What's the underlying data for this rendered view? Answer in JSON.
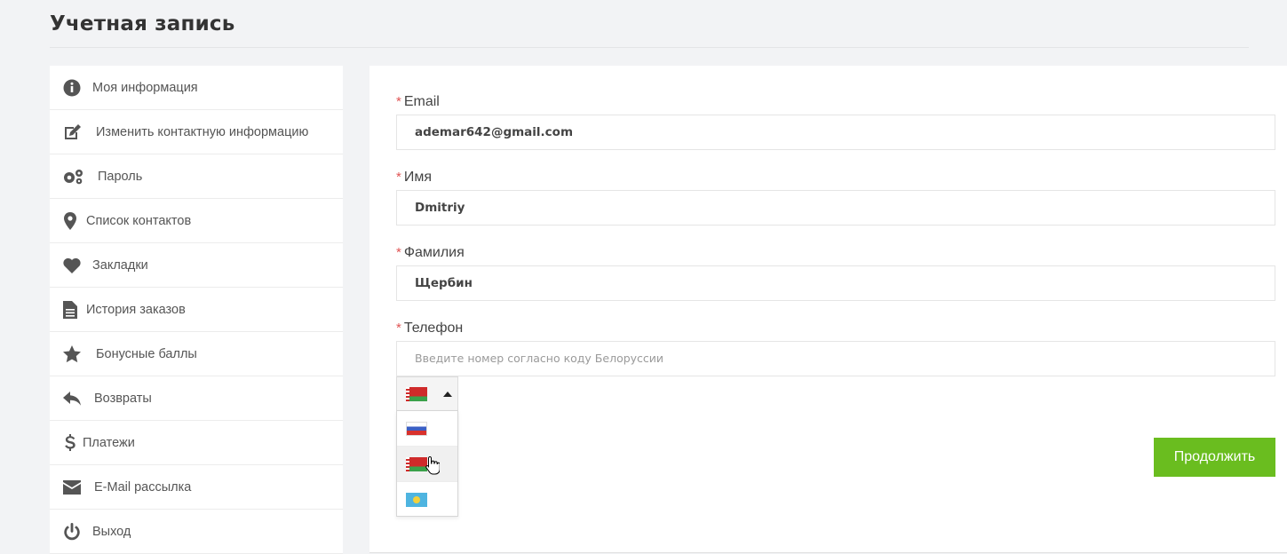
{
  "page": {
    "title": "Учетная запись"
  },
  "sidebar": {
    "items": [
      {
        "label": "Моя информация",
        "icon": "info-icon"
      },
      {
        "label": "Изменить контактную информацию",
        "icon": "edit-icon"
      },
      {
        "label": "Пароль",
        "icon": "gears-icon"
      },
      {
        "label": "Список контактов",
        "icon": "map-marker-icon"
      },
      {
        "label": "Закладки",
        "icon": "heart-icon"
      },
      {
        "label": "История заказов",
        "icon": "document-icon"
      },
      {
        "label": "Бонусные баллы",
        "icon": "star-icon"
      },
      {
        "label": "Возвраты",
        "icon": "reply-icon"
      },
      {
        "label": "Платежи",
        "icon": "dollar-icon"
      },
      {
        "label": "E-Mail рассылка",
        "icon": "envelope-icon"
      },
      {
        "label": "Выход",
        "icon": "power-icon"
      }
    ]
  },
  "form": {
    "required_mark": "*",
    "email": {
      "label": "Email",
      "value": "ademar642@gmail.com"
    },
    "first_name": {
      "label": "Имя",
      "value": "Dmitriy"
    },
    "last_name": {
      "label": "Фамилия",
      "value": "Щербин"
    },
    "phone": {
      "label": "Телефон",
      "value": "",
      "placeholder": "Введите номер согласно коду Белоруссии"
    },
    "country": {
      "selected_flag": "belarus-flag-icon",
      "options": [
        "russia-flag-icon",
        "belarus-flag-icon",
        "kazakhstan-flag-icon"
      ],
      "hovered_index": 1
    },
    "continue_label": "Продолжить"
  },
  "colors": {
    "accent": "#6abd1f",
    "required": "#e05555",
    "background": "#f2f3f5"
  }
}
